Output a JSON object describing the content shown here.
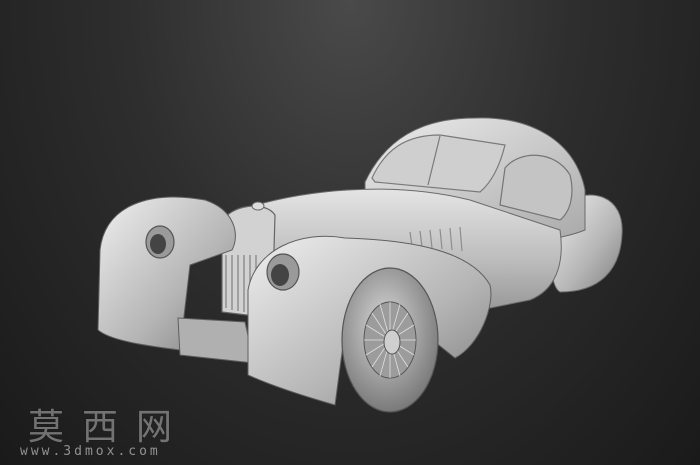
{
  "scene": {
    "background_color": "#2a2a2a",
    "model_color": "#c8c8c8",
    "subject": "3D model render"
  },
  "watermark": {
    "title": "莫西网",
    "url": "www.3dmox.com"
  }
}
